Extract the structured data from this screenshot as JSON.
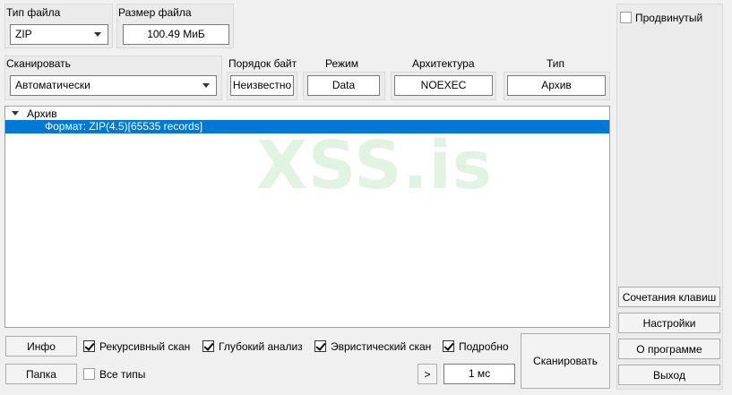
{
  "file_type": {
    "label": "Тип файла",
    "value": "ZIP"
  },
  "file_size": {
    "label": "Размер файла",
    "value": "100.49 МиБ"
  },
  "scan": {
    "label": "Сканировать",
    "value": "Автоматически"
  },
  "endianness": {
    "label": "Порядок байт",
    "value": "Неизвестно"
  },
  "mode": {
    "label": "Режим",
    "value": "Data"
  },
  "architecture": {
    "label": "Архитектура",
    "value": "NOEXEC"
  },
  "type": {
    "label": "Тип",
    "value": "Архив"
  },
  "advanced": {
    "label": "Продвинутый",
    "checked": false
  },
  "tree": {
    "root": "Архив",
    "child": "Формат: ZIP(4.5)[65535 records]"
  },
  "watermark": "XSS.is",
  "options": {
    "recursive": {
      "label": "Рекурсивный скан",
      "checked": true
    },
    "deep": {
      "label": "Глубокий анализ",
      "checked": true
    },
    "heuristic": {
      "label": "Эвристический скан",
      "checked": true
    },
    "verbose": {
      "label": "Подробно",
      "checked": true
    },
    "all_types": {
      "label": "Все типы",
      "checked": false
    }
  },
  "buttons": {
    "info": "Инфо",
    "folder": "Папка",
    "next": ">",
    "time": "1 мс",
    "scan": "Сканировать",
    "shortcuts": "Сочетания клавиш",
    "settings": "Настройки",
    "about": "О программе",
    "exit": "Выход"
  },
  "colors": {
    "selection": "#0078d7",
    "background": "#f0f0f0"
  }
}
